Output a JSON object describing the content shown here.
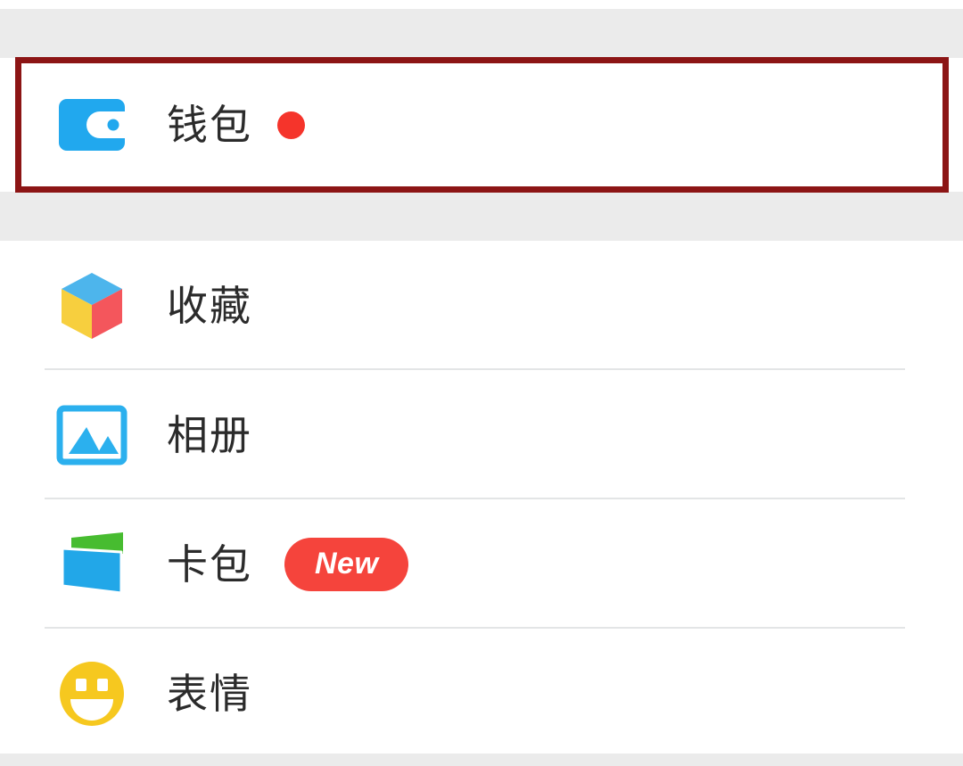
{
  "screen": {
    "title": "WeChat Me / Profile menu",
    "background_color": "#ffffff",
    "band_color": "#ebebeb"
  },
  "annotation": {
    "name": "wallet-row-highlight",
    "color": "#8c1515",
    "target_label": "钱包"
  },
  "groups": [
    {
      "name": "wallet-group",
      "items": [
        {
          "icon": "wallet-icon",
          "label": "钱包",
          "badge_type": "dot",
          "badge_text": "",
          "badge_color": "#f5342b"
        }
      ]
    },
    {
      "name": "main-group",
      "items": [
        {
          "icon": "favorites-cube-icon",
          "label": "收藏",
          "badge_type": "none",
          "badge_text": "",
          "badge_color": ""
        },
        {
          "icon": "album-photo-icon",
          "label": "相册",
          "badge_type": "none",
          "badge_text": "",
          "badge_color": ""
        },
        {
          "icon": "cards-icon",
          "label": "卡包",
          "badge_type": "pill",
          "badge_text": "New",
          "badge_color": "#f5443c"
        },
        {
          "icon": "emoji-smiley-icon",
          "label": "表情",
          "badge_type": "none",
          "badge_text": "",
          "badge_color": ""
        }
      ]
    }
  ],
  "colors": {
    "wallet_blue": "#21a8ee",
    "cube_top_blue": "#4db5ec",
    "cube_left_yellow": "#f7cf3e",
    "cube_right_red": "#f4565c",
    "album_blue": "#2bb0ee",
    "card_front_blue": "#22a7e8",
    "card_back_green": "#47bc30",
    "emoji_yellow": "#f6c81f",
    "divider": "#e3e5e6",
    "text": "#2b2b2b"
  }
}
